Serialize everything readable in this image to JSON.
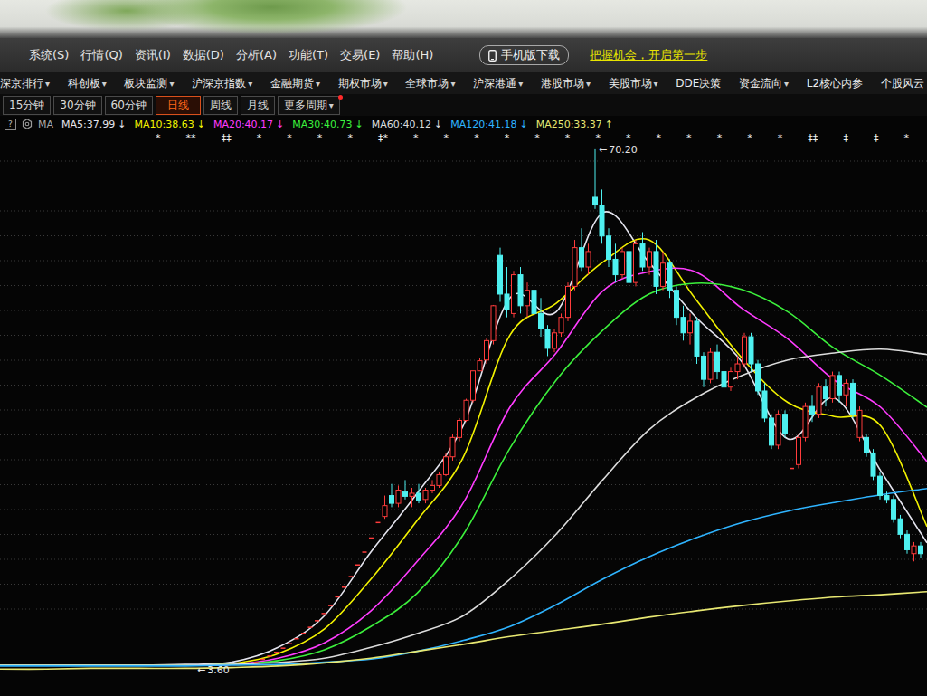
{
  "menu": [
    "系统(S)",
    "行情(Q)",
    "资讯(I)",
    "数据(D)",
    "分析(A)",
    "功能(T)",
    "交易(E)",
    "帮助(H)"
  ],
  "mobile_button": {
    "label": "手机版下载"
  },
  "promo_link": "把握机会，开启第一步",
  "caret": "▾",
  "nav": [
    {
      "label": "深京排行",
      "dropdown": true
    },
    {
      "label": "科创板",
      "dropdown": true
    },
    {
      "label": "板块监测",
      "dropdown": true
    },
    {
      "label": "沪深京指数",
      "dropdown": true
    },
    {
      "label": "金融期货",
      "dropdown": true
    },
    {
      "label": "期权市场",
      "dropdown": true
    },
    {
      "label": "全球市场",
      "dropdown": true
    },
    {
      "label": "沪深港通",
      "dropdown": true
    },
    {
      "label": "港股市场",
      "dropdown": true
    },
    {
      "label": "美股市场",
      "dropdown": true
    },
    {
      "label": "DDE决策",
      "dropdown": false
    },
    {
      "label": "资金流向",
      "dropdown": true
    },
    {
      "label": "L2核心内参",
      "dropdown": false
    },
    {
      "label": "个股风云",
      "dropdown": false
    }
  ],
  "periods": [
    {
      "label": "15分钟",
      "selected": false,
      "dropdown": false,
      "notify": false
    },
    {
      "label": "30分钟",
      "selected": false,
      "dropdown": false,
      "notify": false
    },
    {
      "label": "60分钟",
      "selected": false,
      "dropdown": false,
      "notify": false
    },
    {
      "label": "日线",
      "selected": true,
      "dropdown": false,
      "notify": false
    },
    {
      "label": "周线",
      "selected": false,
      "dropdown": false,
      "notify": false
    },
    {
      "label": "月线",
      "selected": false,
      "dropdown": false,
      "notify": false
    },
    {
      "label": "更多周期",
      "selected": false,
      "dropdown": true,
      "notify": true
    }
  ],
  "indicator_bar": {
    "help": "?",
    "prefix": "MA"
  },
  "signal_markers": [
    "*",
    "**",
    "‡‡",
    "*",
    "*",
    "*",
    "*",
    "‡*",
    "*",
    "*",
    "*",
    "*",
    "*",
    "*",
    "*",
    "*",
    "*",
    "*",
    "*",
    "*",
    "*",
    "‡‡",
    "‡",
    "‡",
    "*"
  ],
  "chart": {
    "high_label": {
      "arrow": "←",
      "text": "70.20"
    },
    "low_label": {
      "arrow": "←",
      "text": "3.60"
    },
    "candles": [
      [
        3.96,
        3.96,
        3.96,
        3.96
      ],
      [
        4.36,
        4.36,
        4.36,
        4.36
      ],
      [
        4.79,
        4.79,
        4.79,
        4.79
      ],
      [
        5.27,
        5.27,
        5.27,
        5.27
      ],
      [
        5.8,
        5.8,
        5.8,
        5.8
      ],
      [
        6.38,
        6.38,
        6.38,
        6.38
      ],
      [
        7.02,
        7.02,
        7.02,
        7.02
      ],
      [
        7.72,
        7.72,
        7.72,
        7.72
      ],
      [
        8.49,
        8.49,
        8.49,
        8.49
      ],
      [
        9.34,
        9.34,
        9.34,
        9.34
      ],
      [
        10.27,
        10.27,
        10.27,
        10.27
      ],
      [
        11.3,
        11.3,
        11.3,
        11.3
      ],
      [
        12.43,
        12.43,
        12.43,
        12.43
      ],
      [
        13.67,
        13.67,
        13.67,
        13.67
      ],
      [
        15.04,
        15.04,
        15.04,
        15.04
      ],
      [
        16.54,
        16.54,
        16.54,
        16.54
      ],
      [
        18.2,
        18.2,
        18.2,
        18.2
      ],
      [
        20.02,
        20.02,
        20.02,
        20.02
      ],
      [
        22.02,
        22.02,
        22.02,
        22.02
      ],
      [
        22.8,
        25.5,
        22.5,
        24.2
      ],
      [
        25.5,
        27.0,
        24.0,
        24.5
      ],
      [
        24.5,
        26.8,
        24.0,
        26.2
      ],
      [
        26.0,
        27.5,
        25.0,
        25.4
      ],
      [
        25.4,
        26.5,
        24.0,
        25.8
      ],
      [
        25.8,
        27.0,
        24.5,
        24.9
      ],
      [
        25.0,
        26.5,
        24.5,
        26.2
      ],
      [
        26.2,
        27.5,
        25.8,
        26.8
      ],
      [
        26.8,
        28.5,
        26.5,
        28.2
      ],
      [
        28.2,
        31.0,
        28.0,
        30.5
      ],
      [
        30.5,
        33.5,
        30.0,
        33.0
      ],
      [
        33.0,
        35.5,
        32.5,
        35.2
      ],
      [
        35.2,
        38.0,
        35.0,
        37.8
      ],
      [
        37.8,
        41.6,
        37.5,
        41.6
      ],
      [
        41.6,
        43.2,
        41.6,
        42.9
      ],
      [
        43.0,
        45.8,
        42.5,
        45.5
      ],
      [
        45.5,
        50.1,
        45.0,
        50.0
      ],
      [
        56.5,
        57.5,
        50.5,
        51.5
      ],
      [
        51.5,
        55.0,
        48.5,
        49.5
      ],
      [
        49.0,
        54.5,
        48.5,
        54.0
      ],
      [
        54.0,
        55.0,
        49.0,
        50.0
      ],
      [
        50.0,
        53.0,
        48.5,
        52.0
      ],
      [
        52.0,
        52.5,
        48.0,
        49.0
      ],
      [
        49.0,
        51.0,
        46.0,
        47.0
      ],
      [
        47.0,
        47.5,
        43.5,
        44.5
      ],
      [
        44.5,
        47.0,
        44.0,
        46.5
      ],
      [
        46.5,
        49.0,
        46.0,
        48.5
      ],
      [
        48.5,
        53.0,
        48.0,
        52.5
      ],
      [
        52.5,
        58.5,
        52.0,
        57.5
      ],
      [
        57.5,
        60.0,
        54.5,
        55.0
      ],
      [
        55.0,
        58.0,
        54.0,
        57.0
      ],
      [
        64.0,
        70.2,
        62.5,
        63.0
      ],
      [
        63.0,
        65.0,
        58.0,
        59.0
      ],
      [
        59.0,
        60.0,
        55.0,
        56.0
      ],
      [
        56.0,
        58.0,
        53.0,
        54.0
      ],
      [
        54.0,
        57.5,
        53.5,
        57.0
      ],
      [
        57.0,
        58.0,
        52.0,
        53.0
      ],
      [
        53.0,
        58.5,
        52.5,
        58.0
      ],
      [
        58.0,
        59.5,
        54.5,
        55.0
      ],
      [
        55.0,
        57.5,
        54.0,
        57.0
      ],
      [
        57.0,
        58.5,
        51.5,
        52.5
      ],
      [
        52.5,
        57.0,
        52.0,
        55.5
      ],
      [
        55.5,
        56.0,
        51.0,
        52.0
      ],
      [
        52.0,
        52.5,
        47.5,
        48.5
      ],
      [
        48.5,
        50.0,
        45.5,
        46.5
      ],
      [
        46.5,
        49.0,
        45.0,
        48.0
      ],
      [
        48.0,
        48.5,
        42.5,
        43.5
      ],
      [
        43.5,
        44.0,
        39.5,
        40.5
      ],
      [
        40.5,
        44.5,
        40.0,
        44.0
      ],
      [
        44.0,
        45.0,
        40.5,
        41.5
      ],
      [
        41.5,
        43.0,
        38.5,
        39.5
      ],
      [
        39.5,
        42.0,
        39.0,
        41.5
      ],
      [
        41.5,
        43.5,
        40.5,
        42.5
      ],
      [
        42.5,
        46.5,
        42.0,
        46.0
      ],
      [
        46.0,
        46.5,
        41.5,
        42.5
      ],
      [
        42.5,
        43.0,
        38.5,
        39.0
      ],
      [
        39.0,
        40.0,
        35.0,
        35.5
      ],
      [
        35.5,
        36.0,
        31.5,
        32.0
      ],
      [
        32.0,
        36.5,
        31.5,
        36.0
      ],
      [
        36.0,
        36.5,
        33.0,
        33.5
      ],
      [
        29.0,
        29.0,
        29.0,
        29.0
      ],
      [
        29.5,
        33.5,
        29.0,
        33.0
      ],
      [
        33.0,
        37.5,
        32.5,
        37.0
      ],
      [
        37.0,
        38.5,
        35.0,
        36.0
      ],
      [
        36.0,
        40.0,
        35.5,
        39.5
      ],
      [
        39.5,
        40.5,
        37.0,
        38.0
      ],
      [
        38.0,
        41.5,
        37.5,
        41.0
      ],
      [
        41.0,
        41.5,
        37.5,
        38.5
      ],
      [
        38.5,
        40.5,
        37.0,
        40.0
      ],
      [
        40.0,
        40.5,
        35.5,
        36.0
      ],
      [
        33.0,
        37.0,
        32.5,
        36.5
      ],
      [
        33.0,
        33.5,
        30.5,
        31.0
      ],
      [
        31.0,
        31.5,
        27.5,
        28.0
      ],
      [
        28.0,
        28.5,
        25.0,
        25.5
      ],
      [
        25.5,
        26.0,
        24.5,
        25.0
      ],
      [
        25.0,
        25.5,
        22.0,
        22.5
      ],
      [
        22.5,
        23.0,
        20.0,
        20.5
      ],
      [
        20.5,
        21.0,
        18.0,
        18.5
      ],
      [
        18.0,
        19.5,
        17.0,
        19.0
      ],
      [
        19.0,
        19.5,
        17.5,
        18.0
      ]
    ],
    "ma_lines": [
      {
        "label": "MA5:37.99",
        "arrow": "↓",
        "color": "#e4e4ee",
        "values": [
          3.6,
          3.6,
          3.6,
          3.6,
          3.7,
          4.0,
          5.9,
          10.0,
          18.2,
          25.8,
          34.6,
          51.0,
          49.2,
          62.0,
          55.6,
          48.6,
          42.8,
          32.8,
          38.1,
          28.7,
          19.4
        ]
      },
      {
        "label": "MA10:38.63",
        "arrow": "↓",
        "color": "#f2f200",
        "values": [
          3.6,
          3.6,
          3.6,
          3.6,
          3.6,
          3.8,
          5.1,
          8.3,
          14.7,
          22.3,
          30.5,
          46.2,
          50.3,
          55.6,
          58.5,
          50.9,
          43.3,
          37.5,
          35.7,
          34.5,
          21.5
        ]
      },
      {
        "label": "MA20:40.17",
        "arrow": "↓",
        "color": "#ff3cff",
        "values": [
          3.6,
          3.6,
          3.6,
          3.6,
          3.6,
          3.7,
          4.5,
          6.5,
          10.6,
          17.0,
          24.6,
          36.9,
          43.9,
          51.9,
          54.4,
          54.4,
          49.7,
          45.7,
          40.4,
          36.9,
          29.9
        ]
      },
      {
        "label": "MA30:40.73",
        "arrow": "↓",
        "color": "#3cf03c",
        "values": [
          3.6,
          3.6,
          3.6,
          3.6,
          3.6,
          3.7,
          4.2,
          5.6,
          8.6,
          12.9,
          20.5,
          31.6,
          40.4,
          46.8,
          51.5,
          52.9,
          52.1,
          49.2,
          44.5,
          41.0,
          36.9
        ]
      },
      {
        "label": "MA60:40.12",
        "arrow": "↓",
        "color": "#dcdcdc",
        "values": [
          3.6,
          3.6,
          3.6,
          3.6,
          3.6,
          3.7,
          3.95,
          4.5,
          5.9,
          7.7,
          10.0,
          14.7,
          20.5,
          27.5,
          34.0,
          38.1,
          41.0,
          43.0,
          43.9,
          44.4,
          43.7
        ]
      },
      {
        "label": "MA120:41.18",
        "arrow": "↓",
        "color": "#2fb4ff",
        "values": [
          3.5,
          3.5,
          3.5,
          3.5,
          3.5,
          3.6,
          3.7,
          4.0,
          4.4,
          5.4,
          6.8,
          8.6,
          11.4,
          14.7,
          17.6,
          20.0,
          22.0,
          23.5,
          24.6,
          25.6,
          26.4
        ]
      },
      {
        "label": "MA250:33.37",
        "arrow": "↑",
        "color": "#e8e872",
        "values": [
          3.1,
          3.1,
          3.2,
          3.2,
          3.2,
          3.3,
          3.5,
          3.9,
          4.5,
          5.4,
          6.3,
          7.3,
          8.1,
          8.9,
          9.8,
          10.6,
          11.3,
          11.9,
          12.4,
          12.7,
          13.1
        ]
      }
    ]
  }
}
